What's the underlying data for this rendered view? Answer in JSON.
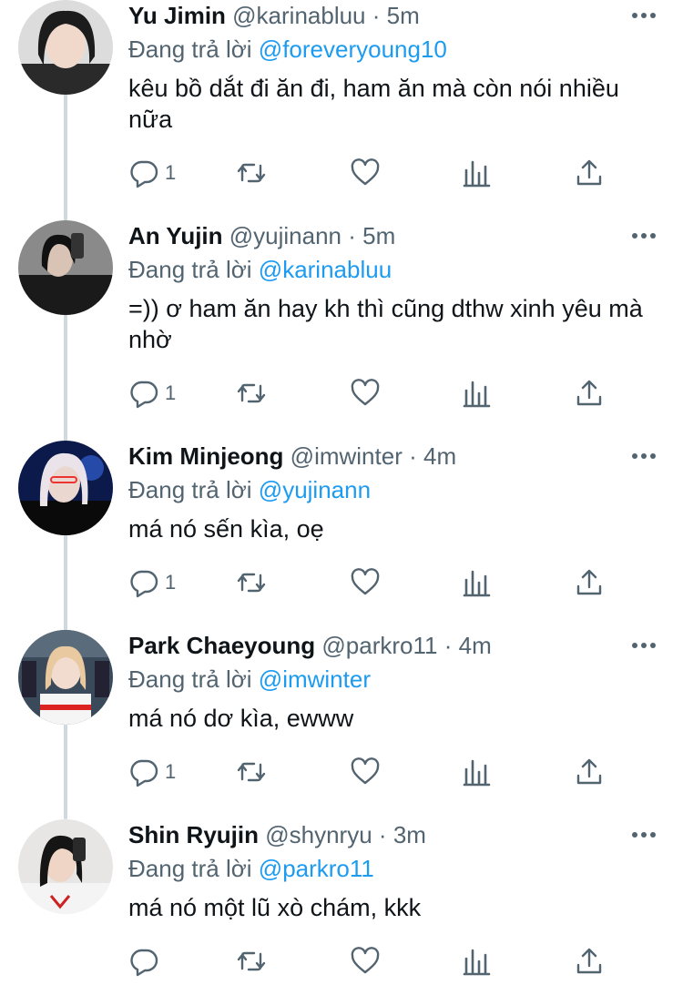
{
  "reply_prefix": "Đang trả lời",
  "tweets": [
    {
      "name": "Yu Jimin",
      "handle": "@karinabluu",
      "dot": "·",
      "time": "5m",
      "replying_to": "@foreveryoung10",
      "text": "kêu bồ dắt đi ăn đi, ham ăn mà còn nói nhiều nữa",
      "reply_count": "1"
    },
    {
      "name": "An Yujin",
      "handle": "@yujinann",
      "dot": "·",
      "time": "5m",
      "replying_to": "@karinabluu",
      "text": "=)) ơ ham ăn hay kh thì cũng dthw xinh yêu mà nhờ",
      "reply_count": "1"
    },
    {
      "name": "Kim Minjeong",
      "handle": "@imwinter",
      "dot": "·",
      "time": "4m",
      "replying_to": "@yujinann",
      "text": "má nó sến kìa, oẹ",
      "reply_count": "1"
    },
    {
      "name": "Park Chaeyoung",
      "handle": "@parkro11",
      "dot": "·",
      "time": "4m",
      "replying_to": "@imwinter",
      "text": "má nó dơ kìa, ewww",
      "reply_count": "1"
    },
    {
      "name": "Shin Ryujin",
      "handle": "@shynryu",
      "dot": "·",
      "time": "3m",
      "replying_to": "@parkro11",
      "text": "má nó một lũ xò chám, kkk",
      "reply_count": ""
    }
  ],
  "colors": {
    "text_primary": "#0f1419",
    "text_secondary": "#536471",
    "link_blue": "#1d9bf0",
    "thread_line": "#cfd9de"
  },
  "icons": {
    "more": "more-horizontal-icon",
    "reply": "reply-bubble-icon",
    "retweet": "retweet-icon",
    "like": "heart-icon",
    "views": "views-bar-chart-icon",
    "share": "share-upload-icon"
  }
}
